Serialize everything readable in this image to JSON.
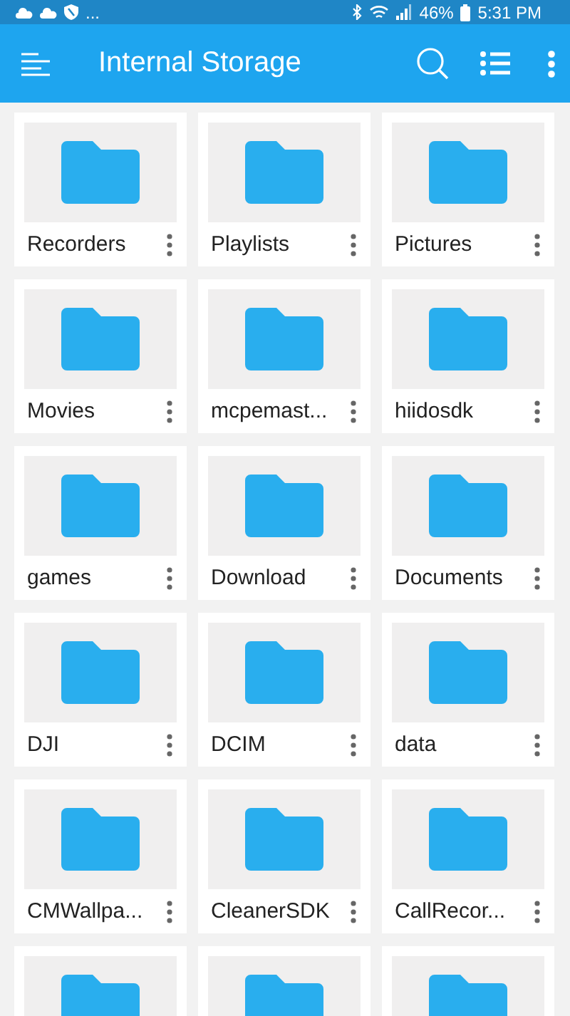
{
  "status_bar": {
    "ellipsis": "...",
    "battery": "46%",
    "time": "5:31 PM"
  },
  "app_bar": {
    "title": "Internal Storage"
  },
  "folders": [
    {
      "kind": "folder",
      "name": "Recorders"
    },
    {
      "kind": "folder",
      "name": "Playlists"
    },
    {
      "kind": "folder",
      "name": "Pictures"
    },
    {
      "kind": "folder",
      "name": "Movies"
    },
    {
      "kind": "folder",
      "name": "mcpemast..."
    },
    {
      "kind": "folder",
      "name": "hiidosdk"
    },
    {
      "kind": "folder",
      "name": "games"
    },
    {
      "kind": "folder",
      "name": "Download"
    },
    {
      "kind": "folder",
      "name": "Documents"
    },
    {
      "kind": "folder",
      "name": "DJI"
    },
    {
      "kind": "folder",
      "name": "DCIM"
    },
    {
      "kind": "folder",
      "name": "data"
    },
    {
      "kind": "folder",
      "name": "CMWallpa..."
    },
    {
      "kind": "folder",
      "name": "CleanerSDK"
    },
    {
      "kind": "folder",
      "name": "CallRecor..."
    },
    {
      "kind": "cut"
    },
    {
      "kind": "cut"
    },
    {
      "kind": "cut"
    }
  ]
}
